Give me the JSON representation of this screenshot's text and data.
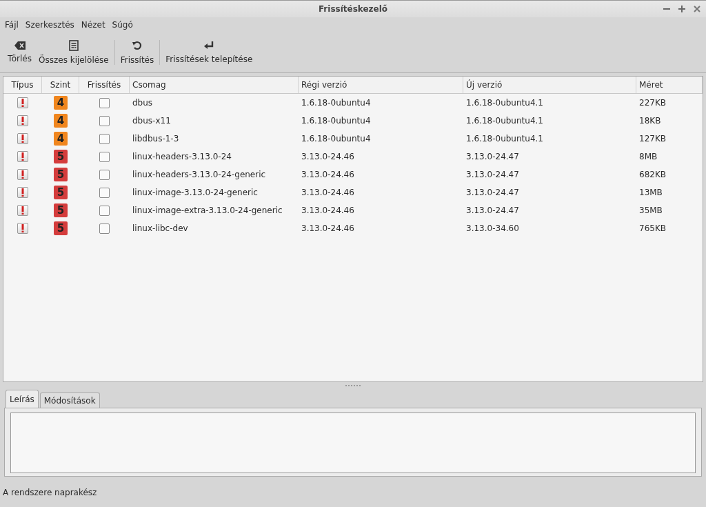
{
  "window": {
    "title": "Frissítéskezelő"
  },
  "menu": [
    "Fájl",
    "Szerkesztés",
    "Nézet",
    "Súgó"
  ],
  "toolbar": [
    {
      "kind": "clear",
      "label": "Törlés"
    },
    {
      "kind": "selectall",
      "label": "Összes kijelölése"
    },
    {
      "kind": "refresh",
      "label": "Frissítés"
    },
    {
      "kind": "install",
      "label": "Frissítések telepítése"
    }
  ],
  "table": {
    "columns": [
      "Típus",
      "Szint",
      "Frissítés",
      "Csomag",
      "Régi verzió",
      "Új verzió",
      "Méret"
    ],
    "rows": [
      {
        "level": "4",
        "color": "#f0861e",
        "checked": false,
        "package": "dbus",
        "old": "1.6.18-0ubuntu4",
        "new": "1.6.18-0ubuntu4.1",
        "size": "227KB"
      },
      {
        "level": "4",
        "color": "#f0861e",
        "checked": false,
        "package": "dbus-x11",
        "old": "1.6.18-0ubuntu4",
        "new": "1.6.18-0ubuntu4.1",
        "size": "18KB"
      },
      {
        "level": "4",
        "color": "#f0861e",
        "checked": false,
        "package": "libdbus-1-3",
        "old": "1.6.18-0ubuntu4",
        "new": "1.6.18-0ubuntu4.1",
        "size": "127KB"
      },
      {
        "level": "5",
        "color": "#d43c3c",
        "checked": false,
        "package": "linux-headers-3.13.0-24",
        "old": "3.13.0-24.46",
        "new": "3.13.0-24.47",
        "size": "8MB"
      },
      {
        "level": "5",
        "color": "#d43c3c",
        "checked": false,
        "package": "linux-headers-3.13.0-24-generic",
        "old": "3.13.0-24.46",
        "new": "3.13.0-24.47",
        "size": "682KB"
      },
      {
        "level": "5",
        "color": "#d43c3c",
        "checked": false,
        "package": "linux-image-3.13.0-24-generic",
        "old": "3.13.0-24.46",
        "new": "3.13.0-24.47",
        "size": "13MB"
      },
      {
        "level": "5",
        "color": "#d43c3c",
        "checked": false,
        "package": "linux-image-extra-3.13.0-24-generic",
        "old": "3.13.0-24.46",
        "new": "3.13.0-24.47",
        "size": "35MB"
      },
      {
        "level": "5",
        "color": "#d43c3c",
        "checked": false,
        "package": "linux-libc-dev",
        "old": "3.13.0-24.46",
        "new": "3.13.0-34.60",
        "size": "765KB"
      }
    ]
  },
  "tabs": [
    {
      "label": "Leírás",
      "selected": true
    },
    {
      "label": "Módosítások",
      "selected": false
    }
  ],
  "status_bar": "A rendszere naprakész"
}
